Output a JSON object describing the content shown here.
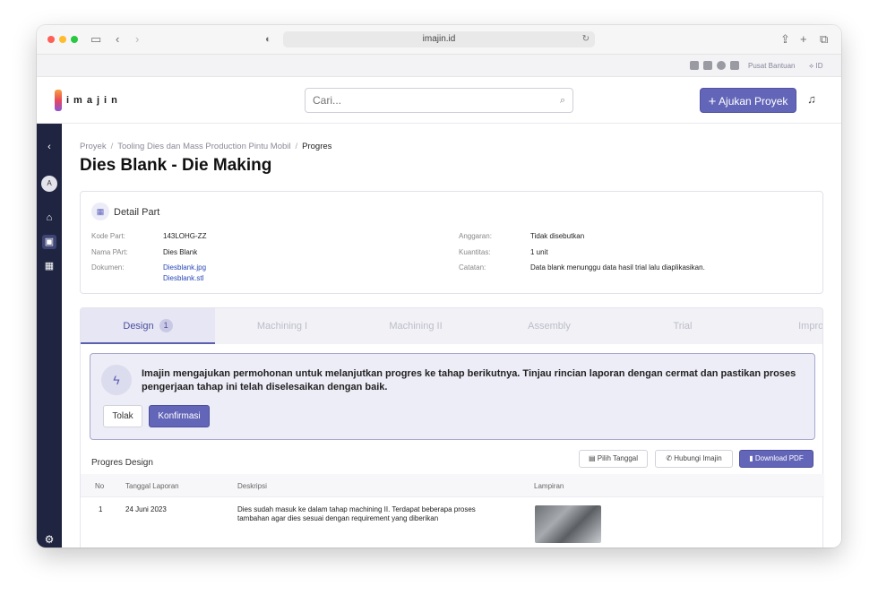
{
  "browser": {
    "url": "imajin.id"
  },
  "topbar": {
    "help": "Pusat Bantuan",
    "lang": "ID"
  },
  "header": {
    "logo": "imajin",
    "search_placeholder": "Cari...",
    "submit_button": "Ajukan Proyek"
  },
  "sidebar": {
    "avatar": "A",
    "items": [
      "home-icon",
      "cube-icon",
      "add-grid-icon"
    ],
    "settings": "gear-icon"
  },
  "breadcrumb": {
    "items": [
      "Proyek",
      "Tooling Dies dan Mass Production Pintu Mobil"
    ],
    "current": "Progres"
  },
  "page": {
    "title": "Dies Blank - Die Making"
  },
  "detail": {
    "title": "Detail Part",
    "left": [
      {
        "label": "Kode Part:",
        "value": "143LOHG-ZZ"
      },
      {
        "label": "Nama PArt:",
        "value": "Dies Blank"
      },
      {
        "label": "Dokumen:",
        "files": [
          "Diesblank.jpg",
          "Diesblank.stl"
        ]
      }
    ],
    "right": [
      {
        "label": "Anggaran:",
        "value": "Tidak disebutkan"
      },
      {
        "label": "Kuantitas:",
        "value": "1 unit"
      },
      {
        "label": "Catatan:",
        "value": "Data blank menunggu data hasil trial lalu diaplikasikan."
      }
    ]
  },
  "tabs": [
    {
      "label": "Design",
      "badge": "1"
    },
    {
      "label": "Machining I"
    },
    {
      "label": "Machining II"
    },
    {
      "label": "Assembly"
    },
    {
      "label": "Trial"
    },
    {
      "label": "Improve"
    }
  ],
  "notice": {
    "text": "Imajin mengajukan permohonan untuk melanjutkan progres ke tahap berikutnya. Tinjau rincian laporan dengan cermat dan pastikan proses pengerjaan tahap ini telah diselesaikan dengan baik.",
    "reject": "Tolak",
    "confirm": "Konfirmasi"
  },
  "progress": {
    "title": "Progres Design",
    "pick_date": "Pilih Tanggal",
    "contact": "Hubungi Imajin",
    "download": "Download PDF",
    "columns": [
      "No",
      "Tanggal Laporan",
      "Deskripsi",
      "Lampiran"
    ],
    "rows": [
      {
        "no": "1",
        "date": "24 Juni 2023",
        "desc": "Dies sudah masuk ke dalam tahap machining II. Terdapat beberapa proses tambahan agar dies sesuai dengan requirement yang diberikan"
      }
    ]
  }
}
